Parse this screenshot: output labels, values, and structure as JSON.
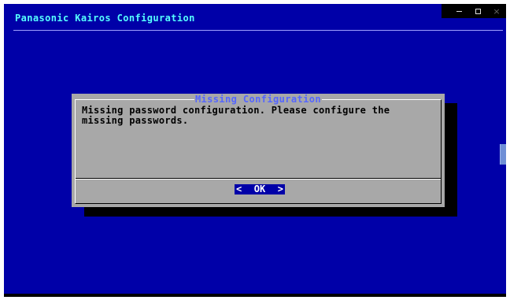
{
  "window": {
    "title": "Panasonic Kairos Configuration",
    "controls": {
      "minimize_icon": "minimize-icon",
      "maximize_icon": "maximize-icon",
      "close_icon": "close-icon",
      "close_glyph": "×"
    }
  },
  "dialog": {
    "title": "Missing Configuration",
    "message": "Missing password configuration. Please configure the\nmissing passwords.",
    "ok_button": {
      "left_bracket": "<",
      "label": "OK",
      "right_bracket": ">"
    }
  },
  "colors": {
    "background": "#0000a8",
    "dialog": "#a8a8a8",
    "title_text": "#55ffff",
    "dialog_title": "#5566ff",
    "button_bg": "#0000a8"
  }
}
